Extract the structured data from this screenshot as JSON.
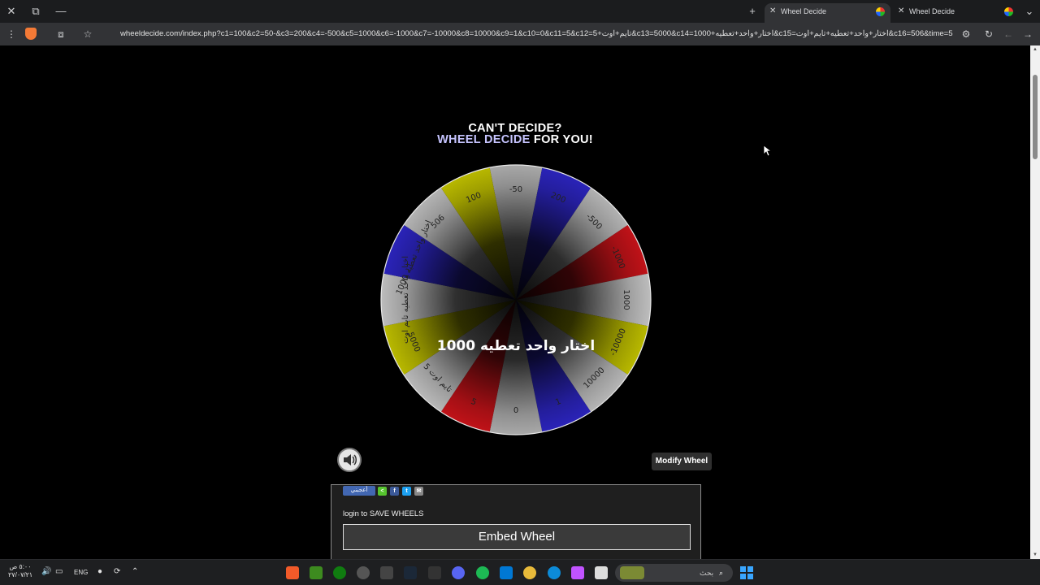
{
  "browser": {
    "tabs": [
      {
        "label": "Wheel Decide",
        "active": true
      },
      {
        "label": "Wheel Decide",
        "active": false
      }
    ],
    "url": "wheeldecide.com/index.php?c1=100&c2=50-&c3=200&c4=-500&c5=1000&c6=-1000&c7=-10000&c8=10000&c9=1&c10=0&c11=5&c12=5+تايم+اوت&c13=5000&c14=1000+اختار+واحد+تعطيه&c15=اختار+واحد+تعطيه+تايم+اوت&c16=506&time=5",
    "new_tab_symbol": "+"
  },
  "page": {
    "headline_line1": "CAN'T DECIDE?",
    "headline_accent": "WHEEL DECIDE",
    "headline_rest": " FOR YOU!",
    "result_label": "اختار واحد تعطيه 1000",
    "modify_button": "Modify Wheel",
    "like_button": "أعجبني",
    "login_text": "login to SAVE WHEELS",
    "embed_button": "Embed Wheel"
  },
  "wheel": {
    "segments": [
      {
        "label": "-50",
        "color": "#a8a8a8"
      },
      {
        "label": "200",
        "color": "#2a23b8"
      },
      {
        "label": "-500",
        "color": "#b2b2b2"
      },
      {
        "label": "-1000",
        "color": "#c01218"
      },
      {
        "label": "1000",
        "color": "#bdbdbd"
      },
      {
        "label": "-10000",
        "color": "#b8b800"
      },
      {
        "label": "10000",
        "color": "#b5b5b5"
      },
      {
        "label": "1",
        "color": "#2a23b8"
      },
      {
        "label": "0",
        "color": "#a8a8a8"
      },
      {
        "label": "5",
        "color": "#c01218"
      },
      {
        "label": "تايم اوت 5",
        "color": "#b8b8b8"
      },
      {
        "label": "5000",
        "color": "#b8b800"
      },
      {
        "label": "اختار واحد تعطيه تايم اوت",
        "color": "#bcbcbc"
      },
      {
        "label": "1000 اختار واحد تعطيه",
        "color": "#2a23b8"
      },
      {
        "label": "506",
        "color": "#b3b3b3"
      },
      {
        "label": "100",
        "color": "#b8b800"
      }
    ]
  },
  "taskbar": {
    "time": "٥:٠٠ ص",
    "date": "٢٧/٠٧/٢١",
    "language": "ENG",
    "search_placeholder": "بحث"
  }
}
